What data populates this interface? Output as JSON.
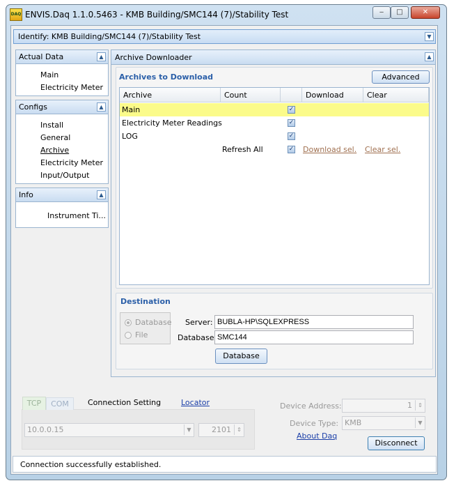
{
  "window": {
    "icon_text": "DAQ",
    "title": "ENVIS.Daq 1.1.0.5463 - KMB Building/SMC144 (7)/Stability Test",
    "minimize": "‒",
    "maximize": "□",
    "close": "✕"
  },
  "identify": {
    "label": "Identify: KMB Building/SMC144 (7)/Stability Test",
    "chevron_icon": "chevron-down-icon"
  },
  "sidebar": {
    "actual_data": {
      "title": "Actual Data",
      "items": [
        "Main",
        "Electricity Meter"
      ]
    },
    "configs": {
      "title": "Configs",
      "items": [
        "Install",
        "General",
        "Archive",
        "Electricity Meter",
        "Input/Output"
      ],
      "active": "Archive"
    },
    "info": {
      "title": "Info",
      "items": [
        "Instrument Ti..."
      ]
    }
  },
  "archive_downloader": {
    "title": "Archive Downloader",
    "archives_title": "Archives to Download",
    "advanced_button": "Advanced",
    "columns": [
      "Archive",
      "Count",
      "",
      "Download",
      "Clear"
    ],
    "rows": [
      {
        "archive": "Main",
        "count": "",
        "checked": true,
        "selected": true
      },
      {
        "archive": "Electricity Meter Readings",
        "count": "",
        "checked": true,
        "selected": false
      },
      {
        "archive": "LOG",
        "count": "",
        "checked": true,
        "selected": false
      }
    ],
    "footer_row": {
      "refresh_label": "Refresh All",
      "checked": true,
      "download_link": "Download sel.",
      "clear_link": "Clear sel."
    }
  },
  "destination": {
    "title": "Destination",
    "options": [
      "Database",
      "File"
    ],
    "selected_option": "Database",
    "server_label": "Server:",
    "server_value": "BUBLA-HP\\SQLEXPRESS",
    "database_label": "Database:",
    "database_value": "SMC144",
    "database_button": "Database"
  },
  "connection": {
    "tabs": [
      "TCP",
      "COM"
    ],
    "setting_label": "Connection Setting",
    "locator_link": "Locator",
    "ip_value": "10.0.0.15",
    "port_value": "2101",
    "device_address_label": "Device Address:",
    "device_address_value": "1",
    "device_type_label": "Device Type:",
    "device_type_value": "KMB",
    "about_link": "About Daq",
    "disconnect_button": "Disconnect"
  },
  "status": {
    "message": "Connection successfully established."
  },
  "colors": {
    "selected_row": "#fbfb8a",
    "group_title": "#2b5fa8",
    "link_blue": "#1a3ea8",
    "link_brown": "#a07050"
  }
}
